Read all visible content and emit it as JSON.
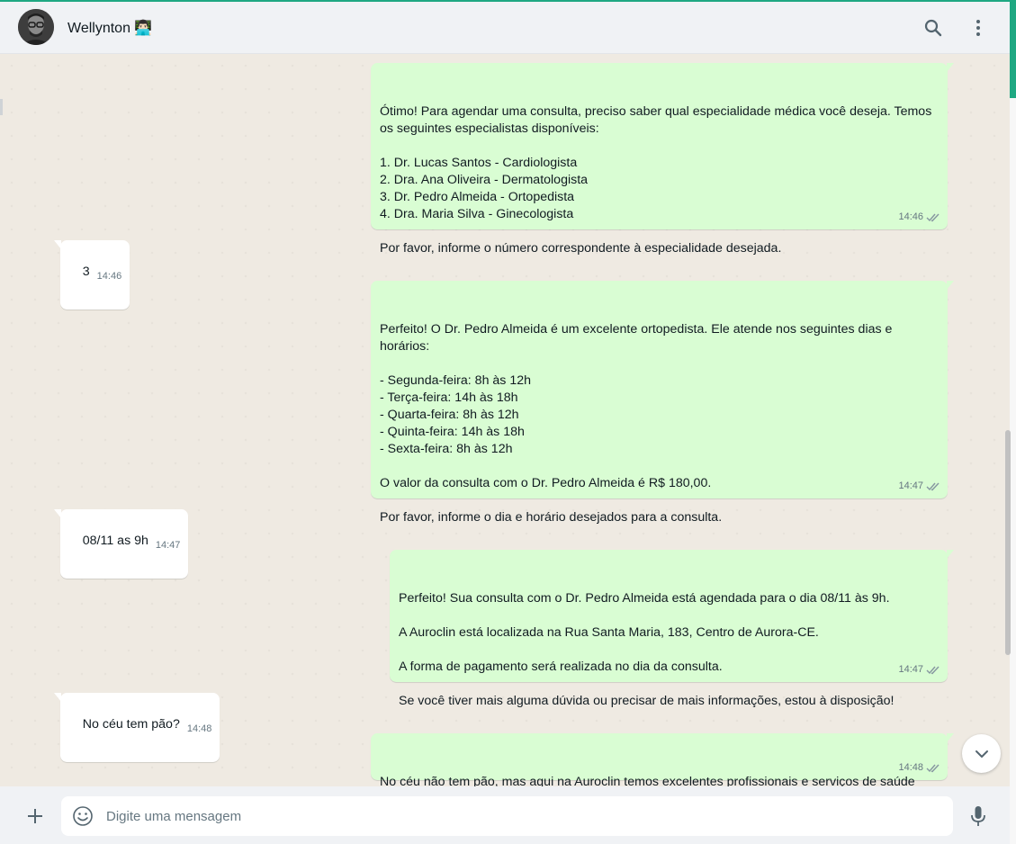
{
  "header": {
    "contact_name": "Wellynton 👨🏻‍💻",
    "search_icon": "search-icon",
    "menu_icon": "kebab-menu-icon"
  },
  "messages": [
    {
      "direction": "outgoing",
      "text": "Ótimo! Para agendar uma consulta, preciso saber qual especialidade médica você deseja. Temos\nos seguintes especialistas disponíveis:\n\n1. Dr. Lucas Santos - Cardiologista\n2. Dra. Ana Oliveira - Dermatologista\n3. Dr. Pedro Almeida - Ortopedista\n4. Dra. Maria Silva - Ginecologista\n\nPor favor, informe o número correspondente à especialidade desejada.",
      "time": "14:46",
      "status": "read"
    },
    {
      "direction": "incoming",
      "text": "3",
      "time": "14:46"
    },
    {
      "direction": "outgoing",
      "text": "Perfeito! O Dr. Pedro Almeida é um excelente ortopedista. Ele atende nos seguintes dias e\nhorários:\n\n- Segunda-feira: 8h às 12h\n- Terça-feira: 14h às 18h\n- Quarta-feira: 8h às 12h\n- Quinta-feira: 14h às 18h\n- Sexta-feira: 8h às 12h\n\nO valor da consulta com o Dr. Pedro Almeida é R$ 180,00.\n\nPor favor, informe o dia e horário desejados para a consulta.",
      "time": "14:47",
      "status": "read"
    },
    {
      "direction": "incoming",
      "text": "08/11 as 9h",
      "time": "14:47"
    },
    {
      "direction": "outgoing",
      "text": "Perfeito! Sua consulta com o Dr. Pedro Almeida está agendada para o dia 08/11 às 9h.\n\nA Auroclin está localizada na Rua Santa Maria, 183, Centro de Aurora-CE.\n\nA forma de pagamento será realizada no dia da consulta.\n\nSe você tiver mais alguma dúvida ou precisar de mais informações, estou à disposição!",
      "time": "14:47",
      "status": "read"
    },
    {
      "direction": "incoming",
      "text": "No céu tem pão?",
      "time": "14:48"
    },
    {
      "direction": "outgoing",
      "text": "No céu não tem pão, mas aqui na Auroclin temos excelentes profissionais e serviços de saúde\npara atender você. Como posso ajudar com o agendamento da sua consulta?",
      "time": "14:48",
      "status": "read"
    }
  ],
  "composer": {
    "placeholder": "Digite uma mensagem",
    "attach_icon": "plus-icon",
    "emoji_icon": "emoji-icon",
    "mic_icon": "microphone-icon"
  },
  "scroll_down_icon": "chevron-down-icon",
  "colors": {
    "accent": "#1fa882",
    "outgoing_bubble": "#d9fdd3",
    "incoming_bubble": "#ffffff",
    "chat_background": "#efeae2",
    "read_ticks": "#8696a0"
  }
}
